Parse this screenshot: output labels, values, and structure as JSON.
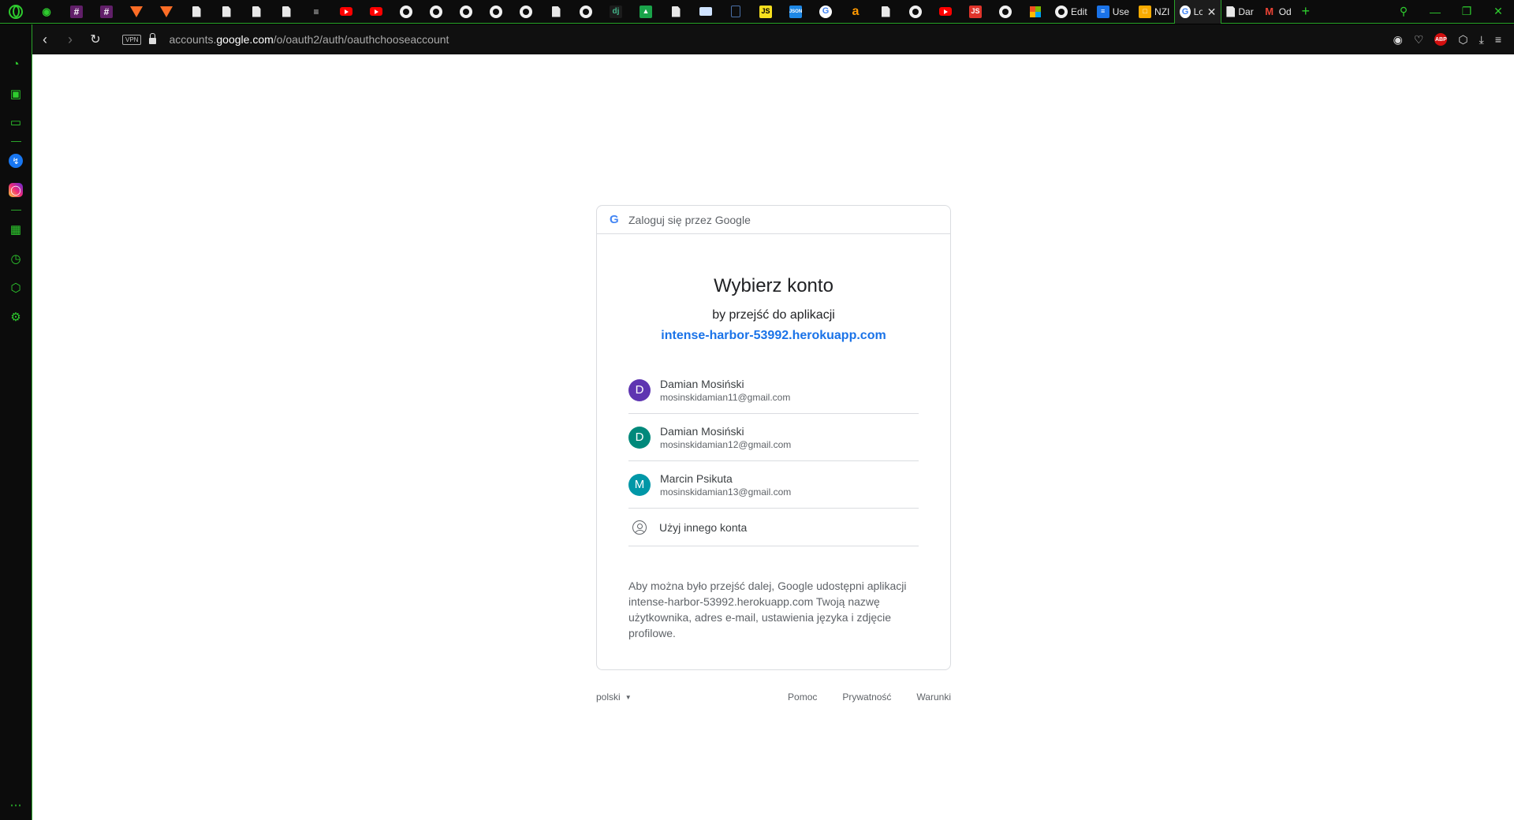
{
  "window": {
    "tabs": {
      "pinned_icons": [
        "gamepad-icon",
        "slack-icon",
        "slack-icon",
        "gitlab-icon",
        "gitlab-icon",
        "doc-icon",
        "doc-icon",
        "doc-icon",
        "doc-icon",
        "stackoverflow-icon",
        "youtube-icon",
        "youtube-icon",
        "github-icon",
        "github-icon",
        "github-icon",
        "github-icon",
        "github-icon",
        "doc-icon",
        "globe-icon",
        "django-icon",
        "chart-icon",
        "doc-icon",
        "book-icon",
        "doc-icon",
        "javascript-icon",
        "json-icon",
        "google-icon",
        "amazon-icon",
        "doc-icon",
        "github-icon",
        "youtube-icon",
        "javascript-icon",
        "github-icon",
        "microsoft-icon"
      ],
      "labeled": [
        {
          "icon": "github-icon",
          "label": "Edit"
        },
        {
          "icon": "docs-icon",
          "label": "Use"
        },
        {
          "icon": "nzi-icon",
          "label": "NZI"
        },
        {
          "icon": "google-icon",
          "label": "Lo",
          "active": true
        },
        {
          "icon": "doc-icon",
          "label": "Dar"
        },
        {
          "icon": "gmail-icon",
          "label": "Od"
        }
      ]
    }
  },
  "toolbar": {
    "vpn_label": "VPN",
    "url_prefix": "accounts.",
    "url_domain": "google.com",
    "url_path": "/o/oauth2/auth/oauthchooseaccount"
  },
  "card": {
    "header_text": "Zaloguj się przez Google",
    "title": "Wybierz konto",
    "subtitle": "by przejść do aplikacji",
    "app_link": "intense-harbor-53992.herokuapp.com",
    "accounts": [
      {
        "initial": "D",
        "name": "Damian Mosiński",
        "email": "mosinskidamian11@gmail.com",
        "color": "#5e35b1"
      },
      {
        "initial": "D",
        "name": "Damian Mosiński",
        "email": "mosinskidamian12@gmail.com",
        "color": "#00897b"
      },
      {
        "initial": "M",
        "name": "Marcin Psikuta",
        "email": "mosinskidamian13@gmail.com",
        "color": "#0097a7"
      }
    ],
    "other_account_label": "Użyj innego konta",
    "disclosure": "Aby można było przejść dalej, Google udostępni aplikacji intense-harbor-53992.herokuapp.com Twoją nazwę użytkownika, adres e-mail, ustawienia języka i zdjęcie profilowe."
  },
  "footer": {
    "language": "polski",
    "links": [
      "Pomoc",
      "Prywatność",
      "Warunki"
    ]
  },
  "colors": {
    "accent": "#2ecc2e",
    "link": "#1a73e8"
  }
}
